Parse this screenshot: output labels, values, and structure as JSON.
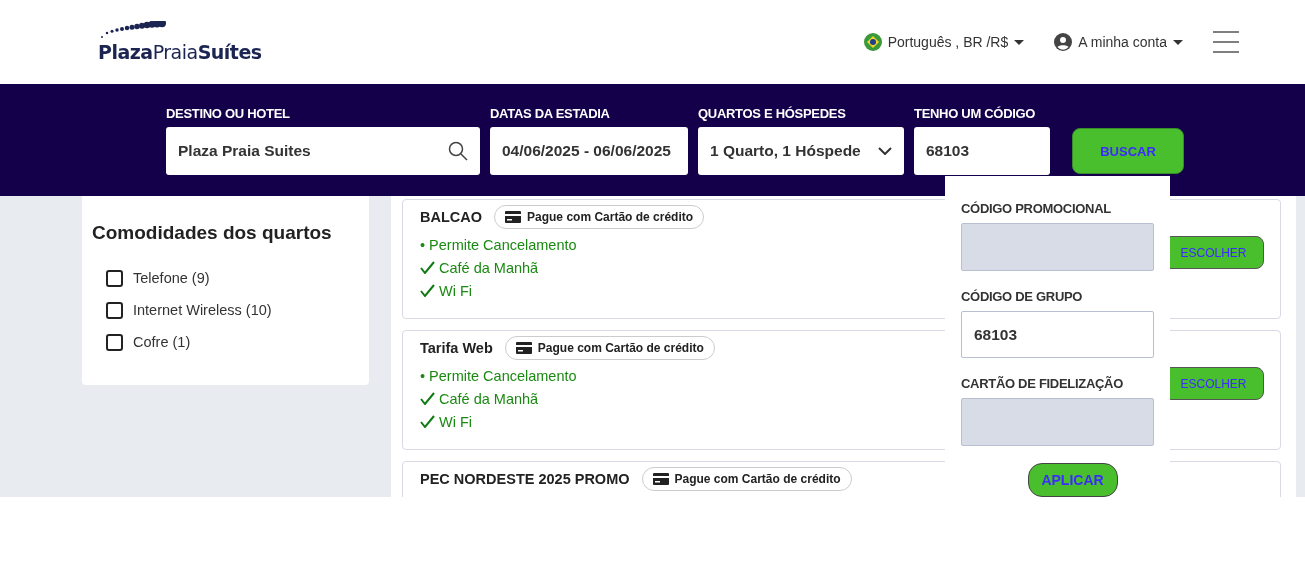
{
  "header": {
    "logo": {
      "part_1": "Plaza",
      "part_2": "Praia",
      "part_3": "Suítes"
    },
    "language": "Português , BR /R$",
    "account": "A minha conta"
  },
  "search": {
    "fields": [
      {
        "kind": "text",
        "label": "DESTINO OU HOTEL",
        "value": "Plaza Praia Suites"
      },
      {
        "kind": "dates",
        "label": "DATAS DA ESTADIA",
        "value": "04/06/2025 - 06/06/2025"
      },
      {
        "kind": "select",
        "label": "QUARTOS E HÓSPEDES",
        "value": "1 Quarto, 1 Hóspede"
      },
      {
        "kind": "code",
        "label": "TENHO UM CÓDIGO",
        "value": "68103"
      }
    ],
    "button": "BUSCAR"
  },
  "filters": {
    "title": "Comodidades dos quartos",
    "items": [
      {
        "label": "Telefone (9)",
        "checked": false
      },
      {
        "label": "Internet Wireless (10)",
        "checked": false
      },
      {
        "label": "Cofre (1)",
        "checked": false
      }
    ]
  },
  "rates": [
    {
      "name": "BALCAO",
      "badge": "Pague com Cartão de crédito",
      "features": [
        {
          "kind": "bullet",
          "text": "• Permite Cancelamento"
        },
        {
          "kind": "check",
          "text": "Café da Manhã"
        },
        {
          "kind": "check",
          "text": "Wi Fi"
        }
      ],
      "button": "ESCOLHER"
    },
    {
      "name": "Tarifa Web",
      "badge": "Pague com Cartão de crédito",
      "features": [
        {
          "kind": "bullet",
          "text": "• Permite Cancelamento"
        },
        {
          "kind": "check",
          "text": "Café da Manhã"
        },
        {
          "kind": "check",
          "text": "Wi Fi"
        }
      ],
      "button": "ESCOLHER"
    },
    {
      "name": "PEC NORDESTE 2025 PROMO",
      "badge": "Pague com Cartão de crédito"
    }
  ],
  "code_panel": {
    "fields": [
      {
        "label": "CÓDIGO PROMOCIONAL",
        "disabled": true
      },
      {
        "label": "CÓDIGO DE GRUPO",
        "value": "68103",
        "disabled": false
      },
      {
        "label": "CARTÃO DE FIDELIZAÇÃO",
        "disabled": true
      }
    ],
    "button": "APLICAR"
  }
}
